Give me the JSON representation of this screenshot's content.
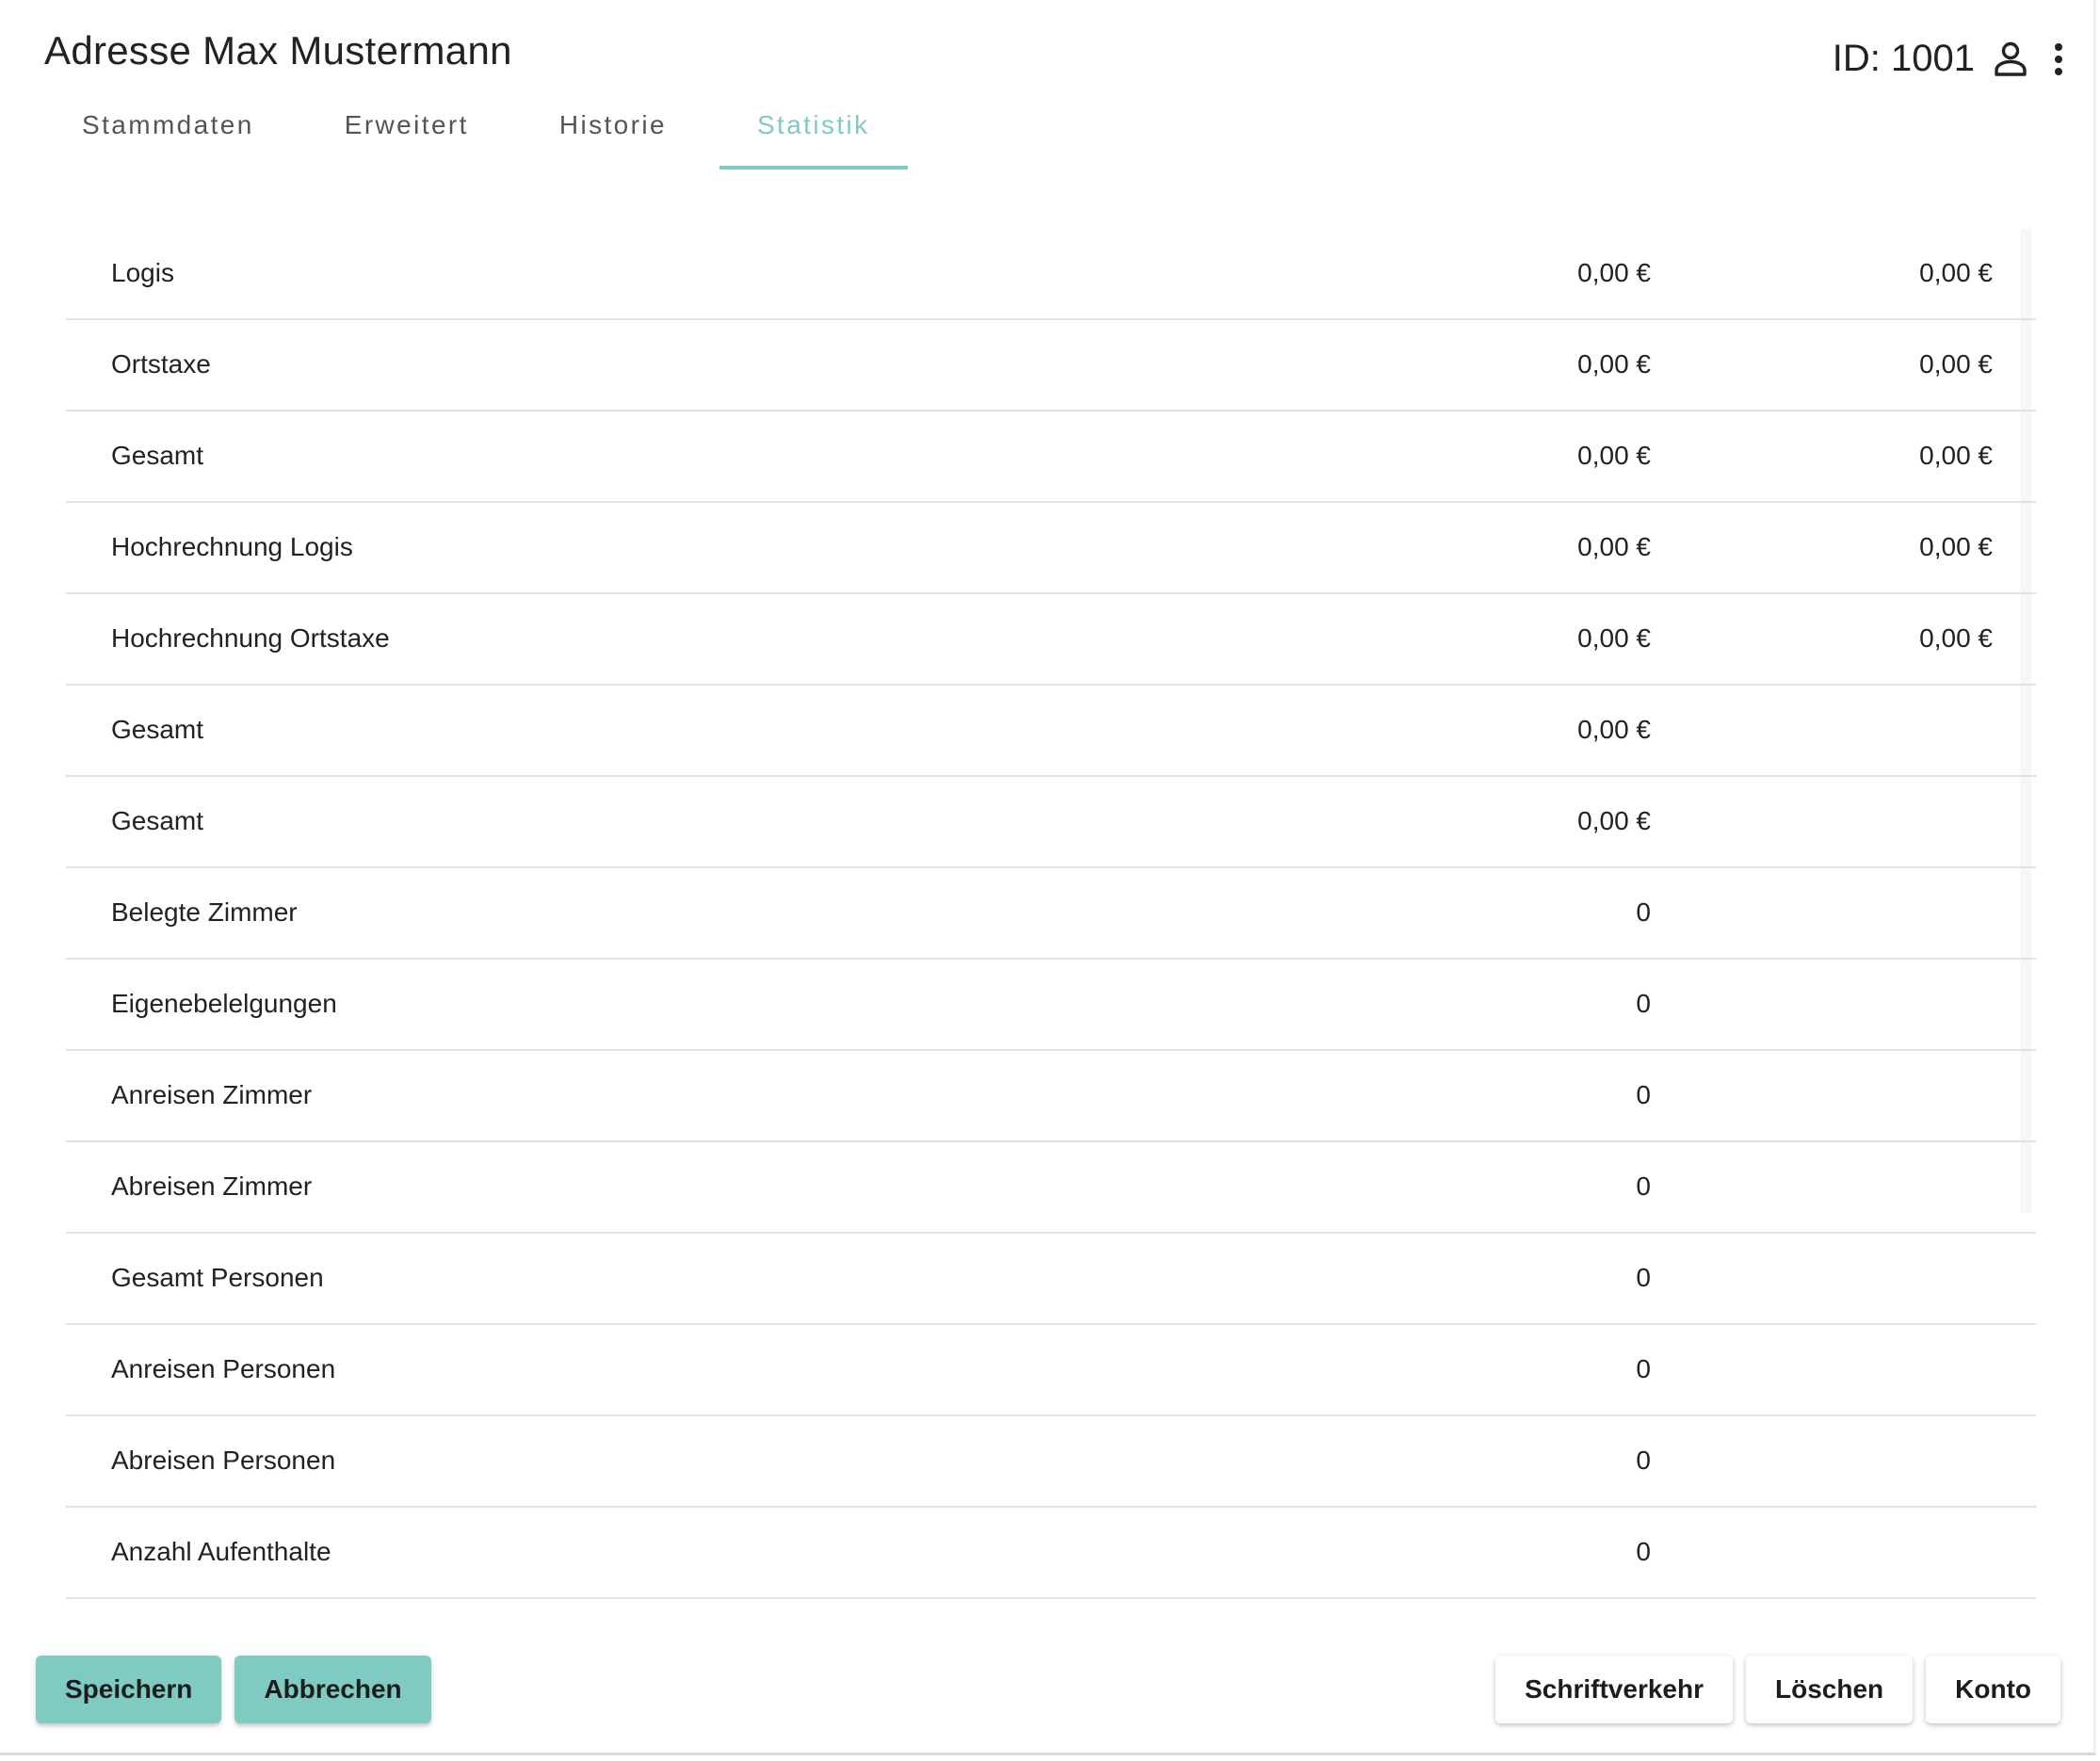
{
  "header": {
    "title": "Adresse Max Mustermann",
    "id_text": "ID: 1001",
    "person_icon": "person-outline-icon",
    "more_icon": "more-vert-icon"
  },
  "tabs": [
    {
      "label": "Stammdaten",
      "active": false
    },
    {
      "label": "Erweitert",
      "active": false
    },
    {
      "label": "Historie",
      "active": false
    },
    {
      "label": "Statistik",
      "active": true
    }
  ],
  "stats": {
    "rows": [
      {
        "label": "Logis",
        "v1": "0,00 €",
        "v2": "0,00 €"
      },
      {
        "label": "Ortstaxe",
        "v1": "0,00 €",
        "v2": "0,00 €"
      },
      {
        "label": "Gesamt",
        "v1": "0,00 €",
        "v2": "0,00 €"
      },
      {
        "label": "Hochrechnung Logis",
        "v1": "0,00 €",
        "v2": "0,00 €"
      },
      {
        "label": "Hochrechnung Ortstaxe",
        "v1": "0,00 €",
        "v2": "0,00 €"
      },
      {
        "label": "Gesamt",
        "v1": "0,00 €",
        "v2": ""
      },
      {
        "label": "Gesamt",
        "v1": "0,00 €",
        "v2": ""
      },
      {
        "label": "Belegte Zimmer",
        "v1": "0",
        "v2": ""
      },
      {
        "label": "Eigenebelelgungen",
        "v1": "0",
        "v2": ""
      },
      {
        "label": "Anreisen Zimmer",
        "v1": "0",
        "v2": ""
      },
      {
        "label": "Abreisen Zimmer",
        "v1": "0",
        "v2": ""
      },
      {
        "label": "Gesamt Personen",
        "v1": "0",
        "v2": ""
      },
      {
        "label": "Anreisen Personen",
        "v1": "0",
        "v2": ""
      },
      {
        "label": "Abreisen Personen",
        "v1": "0",
        "v2": ""
      },
      {
        "label": "Anzahl Aufenthalte",
        "v1": "0",
        "v2": ""
      }
    ]
  },
  "footer": {
    "save_label": "Speichern",
    "cancel_label": "Abbrechen",
    "correspondence_label": "Schriftverkehr",
    "delete_label": "Löschen",
    "account_label": "Konto"
  },
  "colors": {
    "accent": "#7fcbc1",
    "divider": "#e2e2e2"
  }
}
